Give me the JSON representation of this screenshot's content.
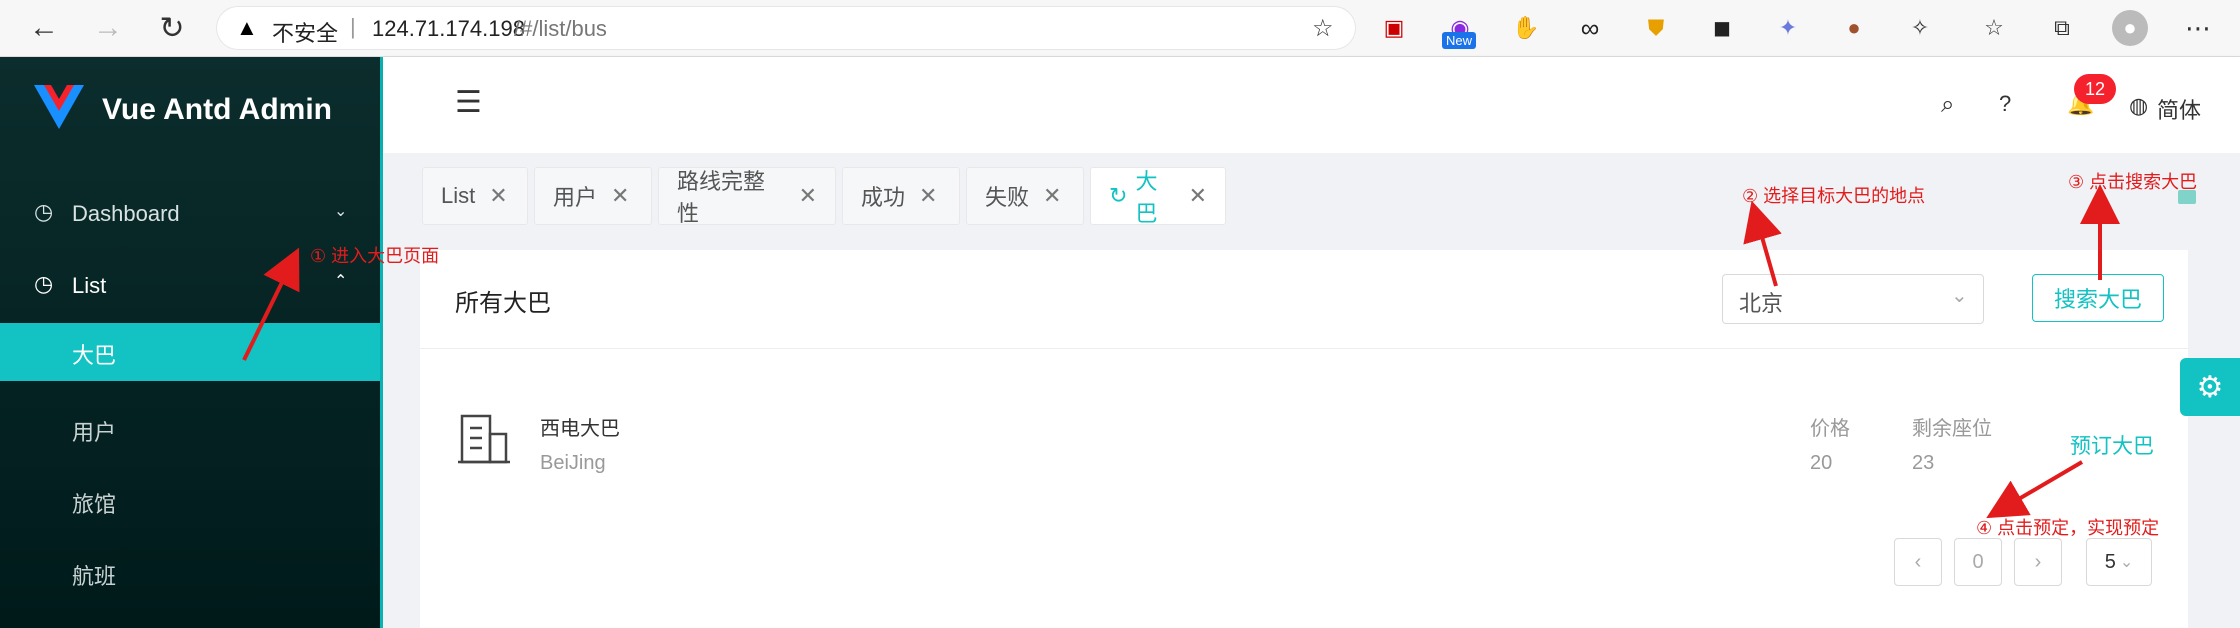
{
  "browser": {
    "warning": "不安全",
    "url_host": "124.71.174.198",
    "url_path": "/#/list/bus",
    "extension_badge": "New"
  },
  "sidebar": {
    "logo": "Vue Antd Admin",
    "items": [
      {
        "label": "Dashboard"
      },
      {
        "label": "List"
      },
      {
        "label": "大巴"
      },
      {
        "label": "用户"
      },
      {
        "label": "旅馆"
      },
      {
        "label": "航班"
      }
    ]
  },
  "header": {
    "notification_count": "12",
    "language": "简体"
  },
  "tabs": [
    {
      "label": "List"
    },
    {
      "label": "用户"
    },
    {
      "label": "路线完整性"
    },
    {
      "label": "成功"
    },
    {
      "label": "失败"
    },
    {
      "label": "大巴"
    }
  ],
  "card": {
    "title": "所有大巴",
    "select_value": "北京",
    "search_button": "搜索大巴"
  },
  "bus": {
    "name": "西电大巴",
    "city": "BeiJing",
    "price_label": "价格",
    "price": "20",
    "seats_label": "剩余座位",
    "seats": "23",
    "book_link": "预订大巴"
  },
  "pagination": {
    "current": "0",
    "page_size": "5"
  },
  "annotations": {
    "a1": "① 进入大巴页面",
    "a2": "② 选择目标大巴的地点",
    "a3": "③ 点击搜索大巴",
    "a4": "④ 点击预定，实现预定"
  },
  "colors": {
    "accent": "#13c2c2",
    "sidebar_bg": "#001a1a",
    "annotation": "#e21c1c",
    "badge": "#f5222d"
  }
}
